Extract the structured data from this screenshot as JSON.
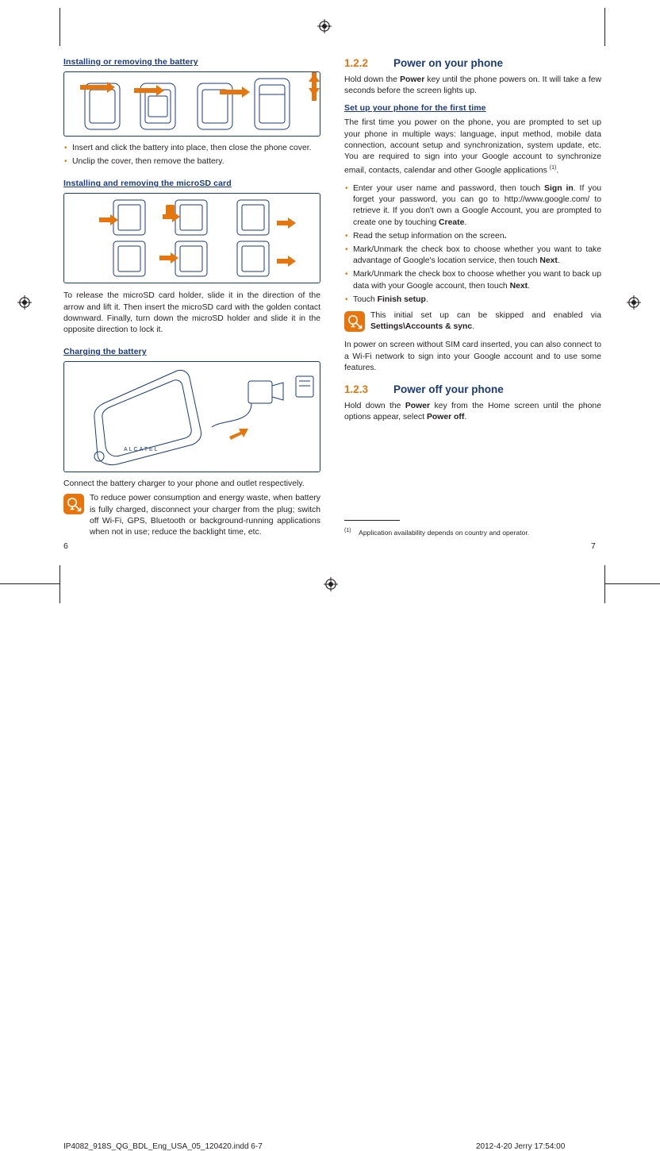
{
  "left_column": {
    "heading_battery": "Installing or removing the battery",
    "battery_bullets": [
      "Insert and click the battery into place, then close the phone cover.",
      "Unclip the cover, then remove the battery."
    ],
    "heading_microsd": "Installing and removing the microSD card",
    "microsd_paragraph": "To release the microSD card holder, slide it in the direction of the arrow and lift it. Then insert the microSD card with the golden contact downward. Finally, turn down the microSD holder and slide it in the opposite direction to lock it.",
    "heading_charging": "Charging the battery",
    "charging_paragraph": "Connect the battery charger to your phone and outlet respectively.",
    "charging_note": "To reduce power consumption and energy waste, when battery is fully charged, disconnect your charger from the plug; switch off Wi-Fi, GPS, Bluetooth or background-running applications when not in use; reduce the backlight time, etc.",
    "page_number": "6"
  },
  "right_column": {
    "section_1_2_2_number": "1.2.2",
    "section_1_2_2_title": "Power on your phone",
    "power_on_paragraph": "Hold down the Power key until the phone powers on. It will take a few seconds before the screen lights up.",
    "power_on_bold_1": "Power",
    "heading_setup": "Set up your phone for the first time",
    "setup_paragraph": "The first time you power on the phone, you are prompted to set up your phone in multiple ways: language, input method, mobile data connection, account setup and synchronization, system update, etc. You are required to sign into your Google account to synchronize email, contacts, calendar and other Google applications (1).",
    "setup_bullets": [
      "Enter your user name and password, then touch Sign in. If you forget your password, you can go to http://www.google.com/ to retrieve it. If you don't own a Google Account, you are prompted to create one by touching Create.",
      "Read the setup information on the screen.",
      "Mark/Unmark the check box to choose whether you want to take advantage of Google's location service, then touch Next.",
      "Mark/Unmark the check box to choose whether you want to back up data with your Google account, then touch Next.",
      "Touch Finish setup."
    ],
    "setup_note": "This initial set up can be skipped and enabled via Settings\\Accounts & sync.",
    "sim_paragraph": "In power on screen without SIM card inserted, you can also connect to a  Wi-Fi network to sign into your Google account and to use some features.",
    "section_1_2_3_number": "1.2.3",
    "section_1_2_3_title": "Power off your phone",
    "power_off_paragraph": "Hold down the Power key from the Home screen until the phone options appear, select Power off.",
    "footnote_marker": "(1)",
    "footnote_text": "Application availability depends on country and operator.",
    "page_number": "7"
  },
  "print_bar": {
    "file_info": "IP4082_918S_QG_BDL_Eng_USA_05_120420.indd   6-7",
    "timestamp": "2012-4-20   Jerry   17:54:00"
  },
  "colors": {
    "accent_orange": "#e8740c",
    "heading_blue": "#1b3a7a",
    "text": "#231f20"
  },
  "icons": {
    "note": "lightbulb-icon",
    "registration": "registration-mark-icon"
  }
}
